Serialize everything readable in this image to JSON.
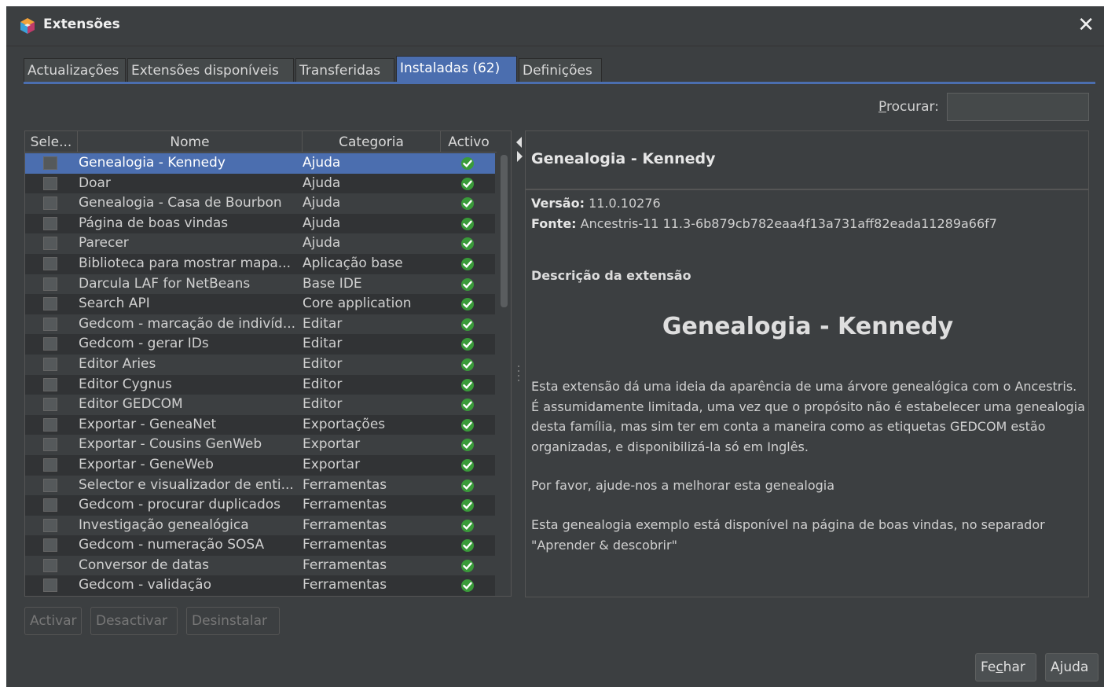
{
  "window": {
    "title": "Extensões",
    "close_glyph": "✕",
    "app_icon": "cube-icon"
  },
  "tabs": [
    {
      "label": "Actualizações",
      "active": false
    },
    {
      "label": "Extensões disponíveis",
      "active": false
    },
    {
      "label": "Transferidas",
      "active": false
    },
    {
      "label": "Instaladas (62)",
      "active": true
    },
    {
      "label": "Definições",
      "active": false
    }
  ],
  "search": {
    "label": "Procurar:",
    "mnemonic": "P",
    "value": ""
  },
  "table": {
    "headers": [
      "Sele...",
      "Nome",
      "Categoria",
      "Activo"
    ],
    "rows": [
      {
        "name": "Genealogia - Kennedy",
        "category": "Ajuda",
        "active": true,
        "selected": true
      },
      {
        "name": "Doar",
        "category": "Ajuda",
        "active": true
      },
      {
        "name": "Genealogia - Casa de Bourbon",
        "category": "Ajuda",
        "active": true
      },
      {
        "name": "Página de boas vindas",
        "category": "Ajuda",
        "active": true
      },
      {
        "name": "Parecer",
        "category": "Ajuda",
        "active": true
      },
      {
        "name": "Biblioteca para mostrar mapa...",
        "category": "Aplicação base",
        "active": true
      },
      {
        "name": "Darcula LAF for NetBeans",
        "category": "Base IDE",
        "active": true
      },
      {
        "name": "Search API",
        "category": "Core application",
        "active": true
      },
      {
        "name": "Gedcom - marcação de indivíd...",
        "category": "Editar",
        "active": true
      },
      {
        "name": "Gedcom - gerar IDs",
        "category": "Editar",
        "active": true
      },
      {
        "name": "Editor Aries",
        "category": "Editor",
        "active": true
      },
      {
        "name": "Editor Cygnus",
        "category": "Editor",
        "active": true
      },
      {
        "name": "Editor GEDCOM",
        "category": "Editor",
        "active": true
      },
      {
        "name": "Exportar - GeneaNet",
        "category": "Exportações",
        "active": true
      },
      {
        "name": "Exportar - Cousins GenWeb",
        "category": "Exportar",
        "active": true
      },
      {
        "name": "Exportar - GeneWeb",
        "category": "Exportar",
        "active": true
      },
      {
        "name": "Selector e visualizador de enti...",
        "category": "Ferramentas",
        "active": true
      },
      {
        "name": "Gedcom - procurar duplicados",
        "category": "Ferramentas",
        "active": true
      },
      {
        "name": "Investigação genealógica",
        "category": "Ferramentas",
        "active": true
      },
      {
        "name": "Gedcom - numeração SOSA",
        "category": "Ferramentas",
        "active": true
      },
      {
        "name": "Conversor de datas",
        "category": "Ferramentas",
        "active": true
      },
      {
        "name": "Gedcom - validação",
        "category": "Ferramentas",
        "active": true
      }
    ]
  },
  "detail": {
    "title": "Genealogia - Kennedy",
    "version_label": "Versão:",
    "version_value": "11.0.10276",
    "source_label": "Fonte:",
    "source_value": "Ancestris-11 11.3-6b879cb782eaa4f13a731aff82eada11289a66f7",
    "section": "Descrição da extensão",
    "big_title": "Genealogia - Kennedy",
    "paragraphs": [
      "Esta extensão dá uma ideia da aparência de uma árvore genealógica com o Ancestris. É assumidamente limitada, uma vez que o propósito não é estabelecer uma genealogia desta família, mas sim ter em conta a maneira como as etiquetas GEDCOM estão organizadas, e disponibilizá-la só em Inglês.",
      "Por favor, ajude-nos a melhorar esta genealogia",
      "Esta genealogia exemplo está disponível na página de boas vindas, no separador \"Aprender & descobrir\""
    ]
  },
  "actions": {
    "activate": "Activar",
    "deactivate": "Desactivar",
    "uninstall": "Desinstalar"
  },
  "footer": {
    "close": "Fechar",
    "close_mnemonic": "c",
    "help": "Ajuda"
  },
  "colors": {
    "background": "#3c3f41",
    "selection": "#4b6eaf",
    "check_green": "#3a9b3a"
  }
}
